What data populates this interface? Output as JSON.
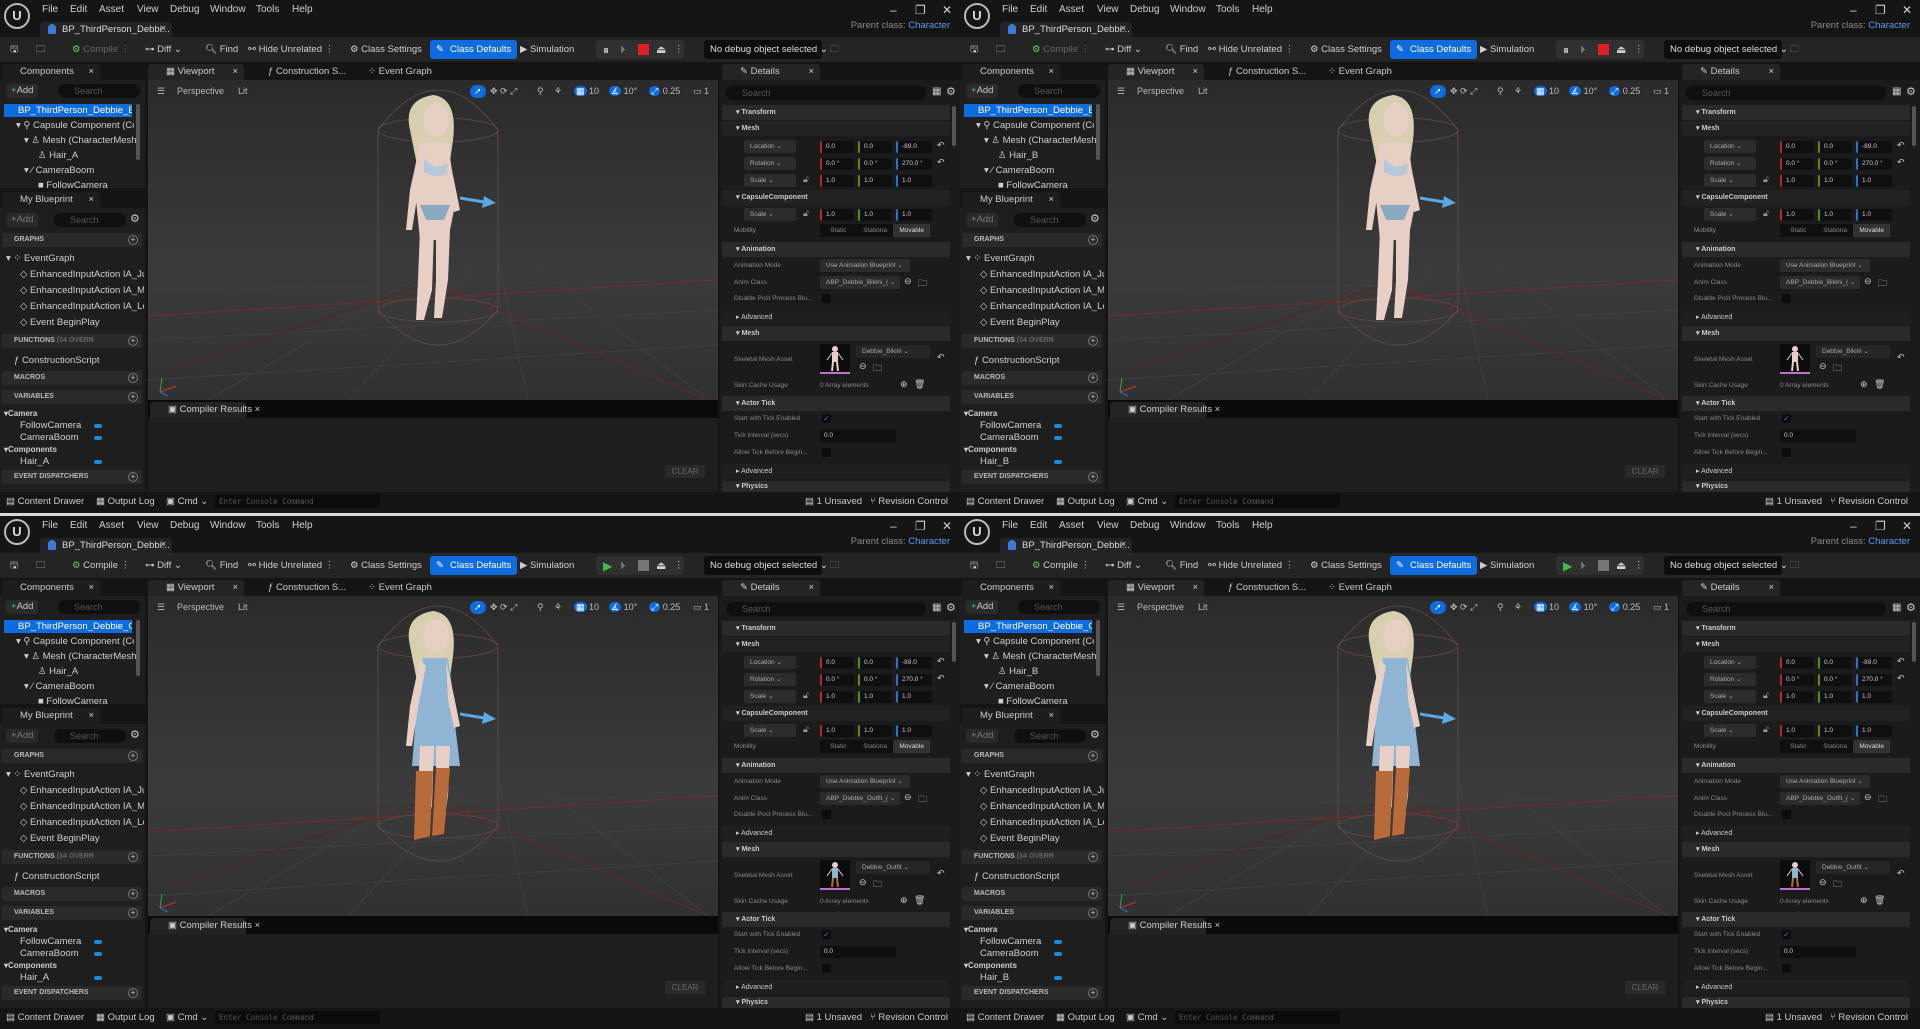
{
  "common": {
    "logo": "U",
    "menu": [
      "File",
      "Edit",
      "Asset",
      "View",
      "Debug",
      "Window",
      "Tools",
      "Help"
    ],
    "window_controls": [
      "–",
      "❐",
      "✕"
    ],
    "parent_class_label": "Parent class:",
    "parent_class_value": "Character",
    "toolbar": {
      "compile": "Compile",
      "diff": "Diff",
      "find": "Find",
      "hide_unrelated": "Hide Unrelated",
      "class_settings": "Class Settings",
      "class_defaults": "Class Defaults",
      "simulation": "Simulation",
      "debug_object": "No debug object selected"
    },
    "panels": {
      "components": "Components",
      "viewport": "Viewport",
      "construction": "Construction S...",
      "event_graph": "Event Graph",
      "details": "Details",
      "my_blueprint": "My Blueprint",
      "compiler_results": "Compiler Results"
    },
    "add": "Add",
    "search_placeholder": "Search",
    "tree": {
      "capsule": "Capsule Component (Co",
      "mesh": "Mesh (CharacterMesh(",
      "camera_boom": "CameraBoom",
      "follow_camera": "FollowCamera"
    },
    "viewport": {
      "perspective": "Perspective",
      "lit": "Lit",
      "grid": "10",
      "angle": "10°",
      "scale": "0.25",
      "camera_speed": "1"
    },
    "blueprint": {
      "graphs": "GRAPHS",
      "event_graph": "EventGraph",
      "events": [
        "EnhancedInputAction IA_Jur",
        "EnhancedInputAction IA_Mo",
        "EnhancedInputAction IA_Loc",
        "Event BeginPlay"
      ],
      "functions": "FUNCTIONS",
      "functions_count": "(34 OVERR",
      "construction_script": "ConstructionScript",
      "macros": "MACROS",
      "variables": "VARIABLES",
      "cat_camera": "Camera",
      "var_follow": "FollowCamera",
      "var_boom": "CameraBoom",
      "cat_components": "Components",
      "event_dispatchers": "EVENT DISPATCHERS"
    },
    "details": {
      "transform": "Transform",
      "mesh": "Mesh",
      "location": "Location",
      "rotation": "Rotation",
      "scale": "Scale",
      "loc": [
        "0.0",
        "0.0",
        "-89.0"
      ],
      "rot": [
        "0.0 °",
        "0.0 °",
        "270.0 °"
      ],
      "scl": [
        "1.0",
        "1.0",
        "1.0"
      ],
      "capsule": "CapsuleComponent",
      "cap_scl": [
        "1.0",
        "1.0",
        "1.0"
      ],
      "mobility": "Mobility",
      "mobility_opts": [
        "Static",
        "Stationa",
        "Movable"
      ],
      "animation": "Animation",
      "animation_mode": "Animation Mode",
      "animation_mode_value": "Use Animation Blueprint",
      "anim_class": "Anim Class",
      "disable_post": "Disable Post Process Blu...",
      "advanced": "Advanced",
      "mesh_section": "Mesh",
      "skeletal_mesh_asset": "Skeletal Mesh Asset",
      "skin_cache": "Skin Cache Usage",
      "skin_cache_value": "0 Array elements",
      "actor_tick": "Actor Tick",
      "start_tick": "Start with Tick Enabled",
      "tick_interval": "Tick Interval (secs)",
      "tick_interval_value": "0.0",
      "allow_tick": "Allow Tick Before Begin...",
      "advanced2": "Advanced",
      "physics": "Physics"
    },
    "clear": "CLEAR",
    "status": {
      "content_drawer": "Content Drawer",
      "output_log": "Output Log",
      "cmd": "Cmd",
      "console_placeholder": "Enter Console Command",
      "unsaved": "1 Unsaved",
      "revision_control": "Revision Control"
    }
  },
  "windows": [
    {
      "doc_tab": "BP_ThirdPerson_Debbi...",
      "root": "BP_ThirdPerson_Debbie_Biki",
      "hair": "Hair_A",
      "anim_class_value": "ABP_Debbie_Bikini_(",
      "mesh_asset": "Debbie_Bikini",
      "simulating": true,
      "outfit": "bikini"
    },
    {
      "doc_tab": "BP_ThirdPerson_Debbi...",
      "root": "BP_ThirdPerson_Debbie_Biki",
      "hair": "Hair_B",
      "anim_class_value": "ABP_Debbie_Bikini_(",
      "mesh_asset": "Debbie_Bikini",
      "simulating": true,
      "outfit": "bikini"
    },
    {
      "doc_tab": "BP_ThirdPerson_Debbi...",
      "root": "BP_ThirdPerson_Debbie_Out",
      "hair": "Hair_A",
      "anim_class_value": "ABP_Debbie_Outfit_(",
      "mesh_asset": "Debbie_Outfit",
      "simulating": false,
      "outfit": "dress"
    },
    {
      "doc_tab": "BP_ThirdPerson_Debbi...",
      "root": "BP_ThirdPerson_Debbie_Out",
      "hair": "Hair_B",
      "anim_class_value": "ABP_Debbie_Outfit_(",
      "mesh_asset": "Debbie_Outfit",
      "simulating": false,
      "outfit": "dress"
    }
  ],
  "colors": {
    "accent": "#0e6be0",
    "link": "#5b9cf0",
    "play": "#3fbf3f",
    "stop": "#e02020",
    "skin": "#e8cfc6",
    "dress": "#8fb4d4",
    "boots": "#b86a3a",
    "hair": "#d8cfb0"
  }
}
